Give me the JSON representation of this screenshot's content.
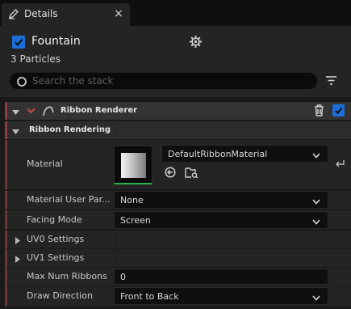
{
  "tab": {
    "title": "Details",
    "close_glyph": "×"
  },
  "header": {
    "emitter_name": "Fountain",
    "particle_count": "3 Particles",
    "search_placeholder": "Search the stack"
  },
  "module": {
    "title": "Ribbon Renderer",
    "enabled": true,
    "category": "Ribbon Rendering"
  },
  "properties": [
    {
      "label": "Material",
      "value": "DefaultRibbonMaterial",
      "type": "asset"
    },
    {
      "label": "Material User Par...",
      "value": "None",
      "type": "dropdown"
    },
    {
      "label": "Facing Mode",
      "value": "Screen",
      "type": "dropdown"
    },
    {
      "label": "UV0 Settings",
      "type": "group"
    },
    {
      "label": "UV1 Settings",
      "type": "group"
    },
    {
      "label": "Max Num Ribbons",
      "value": "0",
      "type": "number"
    },
    {
      "label": "Draw Direction",
      "value": "Front to Back",
      "type": "dropdown"
    }
  ],
  "colors": {
    "accent_blue": "#1a6fd9",
    "thumbnail_underline": "#2bb04f",
    "module_stripe": "#8c3c3c"
  }
}
